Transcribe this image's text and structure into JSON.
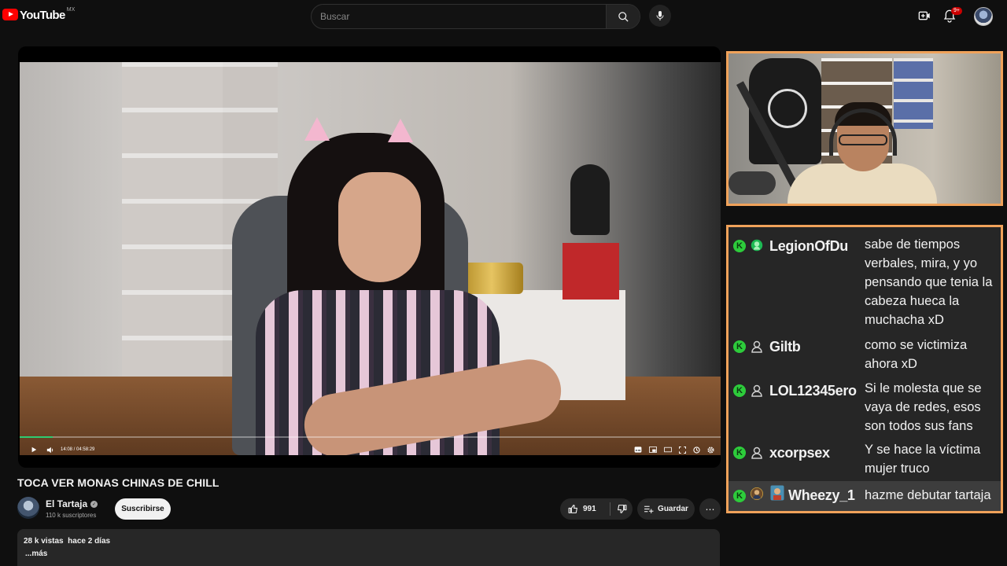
{
  "header": {
    "logo_text": "YouTube",
    "region": "MX",
    "search_placeholder": "Buscar",
    "notification_count": "9+",
    "icons": [
      "search-icon",
      "mic-icon",
      "create-icon",
      "bell-icon"
    ]
  },
  "player": {
    "time": "14:08 / 04:58:29",
    "progress_fraction": 0.047,
    "progress_color": "#2ecc71"
  },
  "video": {
    "title": "TOCA VER MONAS CHINAS DE CHILL",
    "channel_name": "El Tartaja",
    "subscribers": "110 k suscriptores",
    "subscribe_label": "Suscribirse",
    "likes": "991",
    "save_label": "Guardar",
    "views_date": "28 k vistas  hace 2 días",
    "more_label": "...más"
  },
  "overlay": {
    "border_color": "#f0a25a",
    "chat": [
      {
        "user": "LegionOfDu",
        "icon": "green-avatar-icon",
        "message": "sabe de tiempos verbales, mira, y yo pensando que tenia la cabeza hueca la muchacha xD"
      },
      {
        "user": "Giltb",
        "icon": "user-icon",
        "message": "como se victimiza ahora xD"
      },
      {
        "user": "LOL12345ero",
        "icon": "user-icon",
        "message": "Si le molesta que se vaya de redes, esos son todos sus fans"
      },
      {
        "user": "xcorpsex",
        "icon": "user-icon",
        "message": "Y se hace la víctima mujer truco"
      },
      {
        "user": "Wheezy_1",
        "icon": "photo-avatar-icon",
        "message": "hazme debutar tartaja"
      }
    ]
  }
}
